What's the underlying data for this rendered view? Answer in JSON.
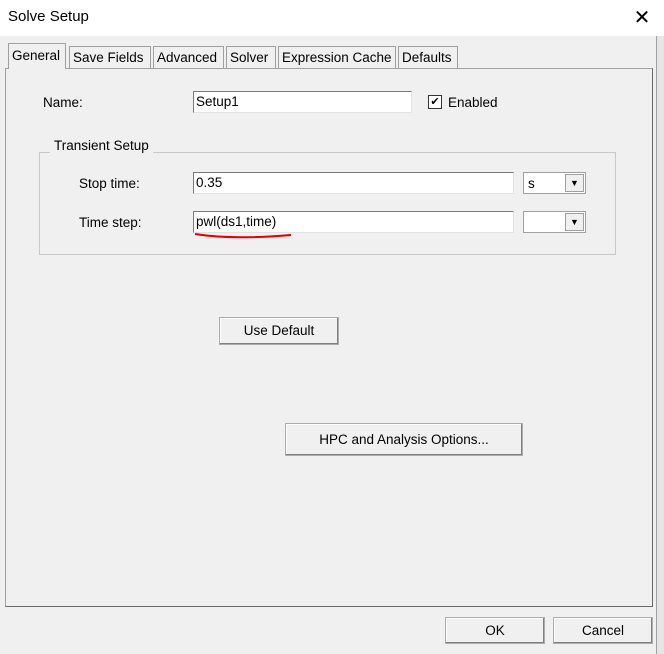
{
  "window": {
    "title": "Solve Setup",
    "close_icon": "close-icon"
  },
  "tabs": [
    {
      "label": "General",
      "active": true
    },
    {
      "label": "Save Fields"
    },
    {
      "label": "Advanced"
    },
    {
      "label": "Solver"
    },
    {
      "label": "Expression Cache"
    },
    {
      "label": "Defaults"
    }
  ],
  "general": {
    "name_label": "Name:",
    "name_value": "Setup1",
    "enabled_label": "Enabled",
    "enabled_checked": true,
    "check_mark": "✔",
    "transient": {
      "title": "Transient Setup",
      "stop_time_label": "Stop time:",
      "stop_time_value": "0.35",
      "stop_time_unit": "s",
      "time_step_label": "Time step:",
      "time_step_value": "pwl(ds1,time)",
      "time_step_unit": ""
    },
    "use_default_label": "Use Default",
    "hpc_label": "HPC and Analysis Options..."
  },
  "footer": {
    "ok_label": "OK",
    "cancel_label": "Cancel"
  },
  "annotation_color": "#e00000"
}
